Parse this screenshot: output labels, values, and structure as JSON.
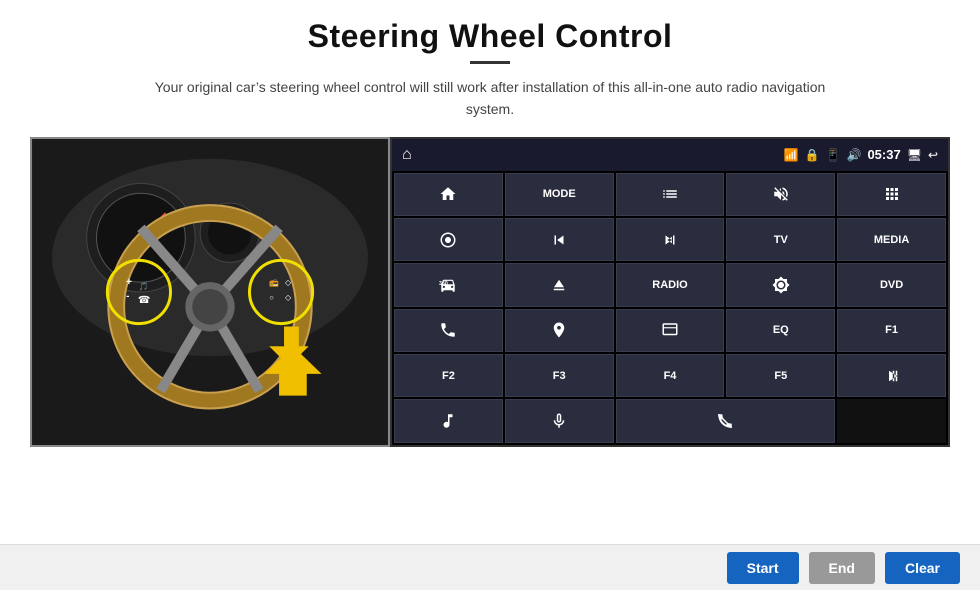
{
  "page": {
    "title": "Steering Wheel Control",
    "subtitle": "Your original car’s steering wheel control will still work after installation of this all-in-one auto radio navigation system."
  },
  "statusbar": {
    "time": "05:37"
  },
  "grid": [
    {
      "id": "r0c0",
      "type": "icon",
      "icon": "home",
      "label": ""
    },
    {
      "id": "r0c1",
      "type": "text",
      "label": "MODE"
    },
    {
      "id": "r0c2",
      "type": "icon",
      "icon": "list",
      "label": ""
    },
    {
      "id": "r0c3",
      "type": "icon",
      "icon": "mute",
      "label": ""
    },
    {
      "id": "r0c4",
      "type": "icon",
      "icon": "apps",
      "label": ""
    },
    {
      "id": "r1c0",
      "type": "icon",
      "icon": "target",
      "label": ""
    },
    {
      "id": "r1c1",
      "type": "icon",
      "icon": "prev",
      "label": ""
    },
    {
      "id": "r1c2",
      "type": "icon",
      "icon": "next",
      "label": ""
    },
    {
      "id": "r1c3",
      "type": "text",
      "label": "TV"
    },
    {
      "id": "r1c4",
      "type": "text",
      "label": "MEDIA"
    },
    {
      "id": "r2c0",
      "type": "icon",
      "icon": "360car",
      "label": ""
    },
    {
      "id": "r2c1",
      "type": "icon",
      "icon": "eject",
      "label": ""
    },
    {
      "id": "r2c2",
      "type": "text",
      "label": "RADIO"
    },
    {
      "id": "r2c3",
      "type": "icon",
      "icon": "brightness",
      "label": ""
    },
    {
      "id": "r2c4",
      "type": "text",
      "label": "DVD"
    },
    {
      "id": "r3c0",
      "type": "icon",
      "icon": "phone",
      "label": ""
    },
    {
      "id": "r3c1",
      "type": "icon",
      "icon": "nav",
      "label": ""
    },
    {
      "id": "r3c2",
      "type": "icon",
      "icon": "window",
      "label": ""
    },
    {
      "id": "r3c3",
      "type": "text",
      "label": "EQ"
    },
    {
      "id": "r3c4",
      "type": "text",
      "label": "F1"
    },
    {
      "id": "r4c0",
      "type": "text",
      "label": "F2"
    },
    {
      "id": "r4c1",
      "type": "text",
      "label": "F3"
    },
    {
      "id": "r4c2",
      "type": "text",
      "label": "F4"
    },
    {
      "id": "r4c3",
      "type": "text",
      "label": "F5"
    },
    {
      "id": "r4c4",
      "type": "icon",
      "icon": "playpause",
      "label": ""
    },
    {
      "id": "r5c0",
      "type": "icon",
      "icon": "music",
      "label": ""
    },
    {
      "id": "r5c1",
      "type": "icon",
      "icon": "mic",
      "label": ""
    },
    {
      "id": "r5c2",
      "type": "icon",
      "icon": "hangup",
      "label": "",
      "wide": 2
    },
    {
      "id": "r5c3",
      "type": "empty",
      "label": ""
    }
  ],
  "bottombar": {
    "start_label": "Start",
    "end_label": "End",
    "clear_label": "Clear"
  }
}
